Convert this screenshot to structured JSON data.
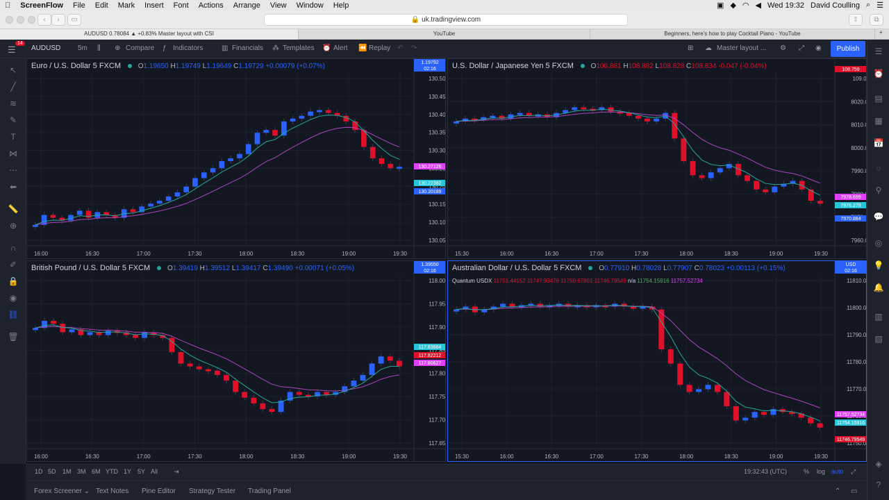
{
  "menubar": {
    "app": "ScreenFlow",
    "items": [
      "File",
      "Edit",
      "Mark",
      "Insert",
      "Font",
      "Actions",
      "Arrange",
      "View",
      "Window",
      "Help"
    ],
    "clock": "Wed 19:32",
    "user": "David Coulling"
  },
  "browser": {
    "url": "uk.tradingview.com",
    "tabs": [
      "AUDUSD 0.78084 ▲ +0.83% Master layout with CSI",
      "YouTube",
      "Beginners, here's how to play Cocktail Piano - YouTube"
    ]
  },
  "toolbar": {
    "symbol": "AUDUSD",
    "interval": "5m",
    "compare": "Compare",
    "indicators": "Indicators",
    "financials": "Financials",
    "templates": "Templates",
    "alert": "Alert",
    "replay": "Replay",
    "layout": "Master layout ...",
    "publish": "Publish",
    "notification_count": "14"
  },
  "panes": [
    {
      "title": "Euro / U.S. Dollar  5  FXCM",
      "o": "1.19650",
      "h": "1.19749",
      "l": "1.19649",
      "c": "1.19729",
      "chg": "+0.00079 (+0.07%)",
      "y_ticks": [
        "130.50000",
        "130.45000",
        "130.40000",
        "130.35000",
        "130.30000",
        "130.25000",
        "130.20000",
        "130.15000",
        "130.10000",
        "130.05000"
      ],
      "x_ticks": [
        "16:00",
        "16:30",
        "17:00",
        "17:30",
        "18:00",
        "18:30",
        "19:00",
        "19:30"
      ],
      "price_labels": [
        {
          "text": "1.19792",
          "sub": "02:16",
          "color": "#2962ff"
        },
        {
          "text": "130.27126",
          "color": "#e040fb"
        },
        {
          "text": "130.22382",
          "color": "#26c6da"
        },
        {
          "text": "130.20189",
          "color": "#2962ff"
        }
      ]
    },
    {
      "title": "U.S. Dollar / Japanese Yen  5  FXCM",
      "o": "108.881",
      "h": "108.882",
      "l": "108.828",
      "c": "108.834",
      "chg": "-0.047 (-0.04%)",
      "y_ticks": [
        "109.000",
        "8020.000",
        "8010.000",
        "8000.000",
        "7990.000",
        "7980.000",
        "7970.000",
        "7960.000"
      ],
      "x_ticks": [
        "15:30",
        "16:00",
        "16:30",
        "17:00",
        "17:30",
        "18:00",
        "18:30",
        "19:00",
        "19:30"
      ],
      "price_labels": [
        {
          "text": "108.759",
          "color": "#e0102a"
        },
        {
          "text": "7978.699",
          "color": "#e040fb"
        },
        {
          "text": "7976.279",
          "color": "#26c6da"
        },
        {
          "text": "7970.884",
          "color": "#2962ff"
        }
      ]
    },
    {
      "title": "British Pound / U.S. Dollar  5  FXCM",
      "o": "1.39419",
      "h": "1.39512",
      "l": "1.39417",
      "c": "1.39490",
      "chg": "+0.00071 (+0.05%)",
      "y_ticks": [
        "118.00000",
        "117.95000",
        "117.90000",
        "117.85000",
        "117.80000",
        "117.75000",
        "117.70000",
        "117.65000"
      ],
      "x_ticks": [
        "16:00",
        "16:30",
        "17:00",
        "17:30",
        "18:00",
        "18:30",
        "19:00",
        "19:30"
      ],
      "price_labels": [
        {
          "text": "1.39550",
          "sub": "02:16",
          "color": "#2962ff"
        },
        {
          "text": "117.83664",
          "color": "#26c6da"
        },
        {
          "text": "117.82212",
          "color": "#e0102a"
        },
        {
          "text": "117.80627",
          "color": "#e040fb"
        }
      ]
    },
    {
      "title": "Australian Dollar / U.S. Dollar  5  FXCM",
      "o": "0.77910",
      "h": "0.78028",
      "l": "0.77907",
      "c": "0.78023",
      "chg": "+0.00113 (+0.15%)",
      "quantum": {
        "name": "Quantum USDX",
        "v1": "11751.44152",
        "v2": "11747.93476",
        "v3": "11750.67851",
        "v4": "11746.79549",
        "na": "n/a",
        "v5": "11754.15916",
        "v6": "11757.52734"
      },
      "y_ticks": [
        "11810.00000",
        "11800.00000",
        "11790.00000",
        "11780.00000",
        "11770.00000",
        "11760.00000",
        "11750.00000"
      ],
      "x_ticks": [
        "15:30",
        "16:00",
        "16:30",
        "17:00",
        "17:30",
        "18:00",
        "18:30",
        "19:00",
        "19:30"
      ],
      "price_labels": [
        {
          "text": "USD",
          "sub": "02:16",
          "color": "#2962ff"
        },
        {
          "text": "11757.52734",
          "color": "#e040fb"
        },
        {
          "text": "11754.15916",
          "color": "#26c6da"
        },
        {
          "text": "11746.79549",
          "color": "#e0102a"
        }
      ]
    }
  ],
  "timeframes": [
    "1D",
    "5D",
    "1M",
    "3M",
    "6M",
    "YTD",
    "1Y",
    "5Y",
    "All"
  ],
  "status": {
    "clock": "19:32:43 (UTC)",
    "pct": "%",
    "log": "log",
    "auto": "auto"
  },
  "bottom_tabs": [
    "Forex Screener",
    "Text Notes",
    "Pine Editor",
    "Strategy Tester",
    "Trading Panel"
  ],
  "colors": {
    "up": "#2962ff",
    "down": "#e0102a",
    "ema_fast": "#26a69a",
    "ema_slow": "#ab47bc",
    "accent": "#2962ff"
  },
  "icons": [
    "apple-icon",
    "menu-icon",
    "crosshair-icon",
    "trend-line-icon",
    "brush-icon",
    "text-icon",
    "measure-icon",
    "zoom-icon",
    "magnet-icon",
    "lock-icon",
    "eye-icon",
    "trash-icon",
    "watchlist-icon",
    "alerts-icon",
    "chat-icon",
    "calendar-icon"
  ]
}
